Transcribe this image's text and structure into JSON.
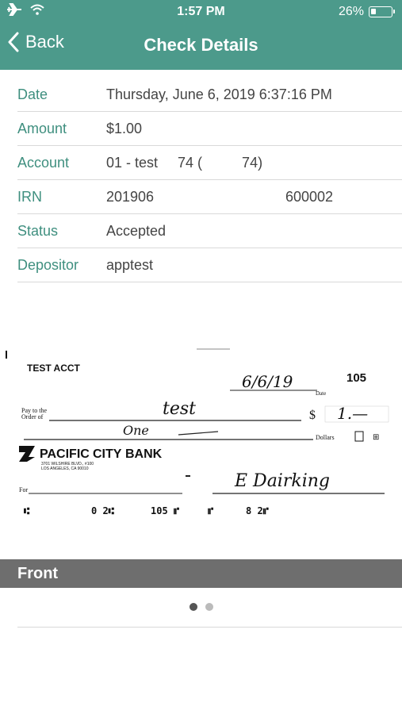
{
  "status_bar": {
    "time": "1:57 PM",
    "battery": "26%",
    "battery_level": 0.26
  },
  "nav": {
    "back_label": "Back",
    "title": "Check Details"
  },
  "details": [
    {
      "label": "Date",
      "value": "Thursday, June 6, 2019 6:37:16 PM",
      "value2": ""
    },
    {
      "label": "Amount",
      "value": "$1.00",
      "value2": ""
    },
    {
      "label": "Account",
      "value": "01 - test     74 (          74)",
      "value2": ""
    },
    {
      "label": "IRN",
      "value": "201906",
      "value2": "600002"
    },
    {
      "label": "Status",
      "value": "Accepted",
      "value2": ""
    },
    {
      "label": "Depositor",
      "value": "apptest",
      "value2": ""
    }
  ],
  "check": {
    "account_name": "TEST ACCT",
    "date": "6/6/19",
    "number": "105",
    "date_label": "Date",
    "pay_to_label_1": "Pay to the",
    "pay_to_label_2": "Order of",
    "payee": "test",
    "dollar_sign": "$",
    "amount": "1.—",
    "amount_words": "One",
    "dollars_label": "Dollars",
    "bank_name_1": "PACIFIC",
    "bank_name_2": "CITY",
    "bank_name_3": "BANK",
    "bank_address_1": "3701 WILSHIRE BLVD., #100",
    "bank_address_2": "LOS ANGELES, CA 90010",
    "for_label": "For",
    "signature": "E Dairking",
    "micr": [
      "⑆",
      "0 2⑆",
      "105 ⑈",
      "⑈",
      "8 2⑈"
    ]
  },
  "page": {
    "label": "Front",
    "current_page": 1,
    "total_pages": 2
  },
  "colors": {
    "accent": "#4c9a8b",
    "label": "#3f8f7f",
    "front_bar": "#6e6e6e",
    "dot_active": "#555555",
    "dot_inactive": "#bbbbbb"
  }
}
